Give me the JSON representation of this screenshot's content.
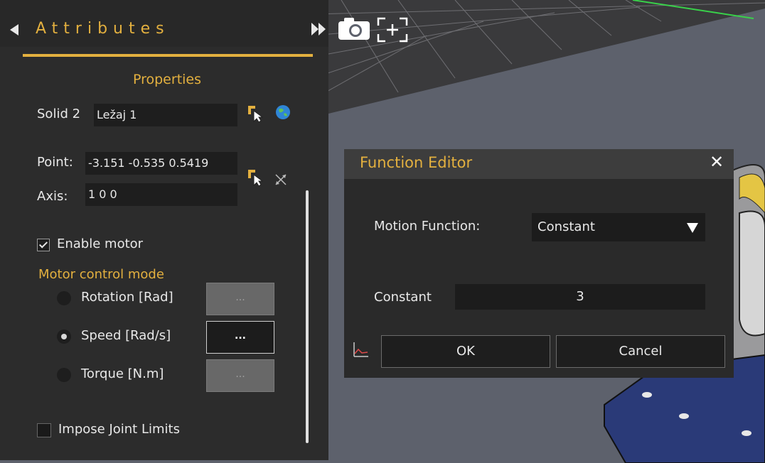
{
  "attributes_panel": {
    "title": "Attributes",
    "section_title": "Properties",
    "solid": {
      "label": "Solid 2",
      "value": "Ležaj 1"
    },
    "point": {
      "label": "Point:",
      "value": "-3.151 -0.535 0.5419"
    },
    "axis": {
      "label": "Axis:",
      "value": "1 0 0"
    },
    "enable_motor": {
      "label": "Enable motor",
      "checked": true
    },
    "motor_control_mode": {
      "title": "Motor control mode",
      "options": [
        {
          "label": "Rotation [Rad]",
          "selected": false,
          "button": "...",
          "enabled": false
        },
        {
          "label": "Speed [Rad/s]",
          "selected": true,
          "button": "...",
          "enabled": true
        },
        {
          "label": "Torque [N.m]",
          "selected": false,
          "button": "...",
          "enabled": false
        }
      ]
    },
    "impose_joint_limits": {
      "label": "Impose Joint Limits",
      "checked": false
    }
  },
  "toolbar": {
    "icons": [
      "expand-panel-icon",
      "camera-icon",
      "focus-frame-icon"
    ]
  },
  "function_editor": {
    "title": "Function Editor",
    "close": "✕",
    "motion_function_label": "Motion Function:",
    "motion_function_value": "Constant",
    "constant_label": "Constant",
    "constant_value": "3",
    "ok_label": "OK",
    "cancel_label": "Cancel"
  },
  "colors": {
    "accent": "#e3b03f",
    "panel_bg": "#2c2c2c",
    "viewport_bg": "#5d616c",
    "dialog_bg": "#2a2a2a"
  }
}
